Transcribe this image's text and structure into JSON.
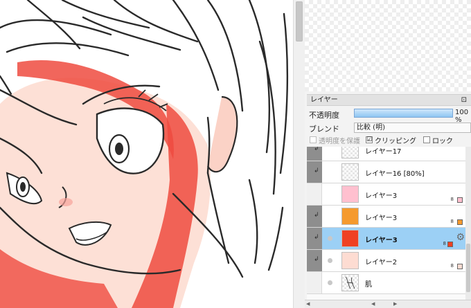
{
  "layer_panel": {
    "title": "レイヤー",
    "dock_glyph": "⊡",
    "opacity_label": "不透明度",
    "opacity_value": "100 %",
    "opacity_fraction": 1.0,
    "blend_label": "ブレンド",
    "blend_value": "比較 (明)",
    "protect_label": "透明度を保護",
    "protect_checked": false,
    "clipping_label": "クリッピング",
    "clipping_checked": true,
    "clipping_mark": "☑",
    "lock_label": "ロック",
    "lock_checked": false
  },
  "layers": [
    {
      "name": "レイヤー17",
      "clip": true,
      "visible": false,
      "thumb": "checker",
      "selected": false,
      "bits": "",
      "color": ""
    },
    {
      "name": "レイヤー16 [80%]",
      "clip": true,
      "visible": false,
      "thumb": "checker",
      "selected": false,
      "bits": "",
      "color": ""
    },
    {
      "name": "レイヤー3",
      "clip": false,
      "visible": false,
      "thumb": "solid",
      "selected": false,
      "bits": "8",
      "color": "#ffc0cf"
    },
    {
      "name": "レイヤー3",
      "clip": true,
      "visible": false,
      "thumb": "solid",
      "selected": false,
      "bits": "8",
      "color": "#f59a2e"
    },
    {
      "name": "レイヤー3",
      "clip": true,
      "visible": true,
      "thumb": "solid",
      "selected": true,
      "bits": "8",
      "color": "#ef4123"
    },
    {
      "name": "レイヤー2",
      "clip": true,
      "visible": true,
      "thumb": "solid",
      "selected": false,
      "bits": "8",
      "color": "#fddcd2"
    },
    {
      "name": "肌",
      "clip": false,
      "visible": true,
      "thumb": "sketch",
      "selected": false,
      "bits": "",
      "color": ""
    }
  ],
  "icons": {
    "clip_arrow": "↲",
    "gear": "⚙",
    "scroll_left": "◀",
    "scroll_right": "▶"
  },
  "colors": {
    "selection": "#9cd0f5",
    "skin_red": "#ef4b40",
    "skin_light": "#fde0d6"
  }
}
